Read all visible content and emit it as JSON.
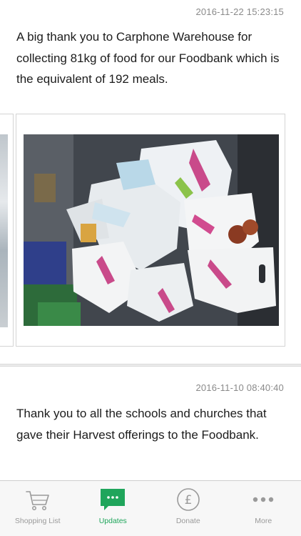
{
  "posts": [
    {
      "timestamp": "2016-11-22 15:23:15",
      "text": "A big thank you to Carphone Warehouse for collecting 81kg of food for our Foodbank which is the equivalent of 192 meals."
    },
    {
      "timestamp": "2016-11-10 08:40:40",
      "text": "Thank you to all the schools and churches that gave their Harvest offerings to the Foodbank."
    }
  ],
  "tabs": [
    {
      "label": "Shopping List",
      "icon": "shopping-cart-icon",
      "active": false
    },
    {
      "label": "Updates",
      "icon": "chat-bubble-icon",
      "active": true
    },
    {
      "label": "Donate",
      "icon": "pound-coin-icon",
      "active": false
    },
    {
      "label": "More",
      "icon": "more-dots-icon",
      "active": false
    }
  ],
  "colors": {
    "accent": "#1fa55b",
    "inactive": "#9a9a9a"
  }
}
